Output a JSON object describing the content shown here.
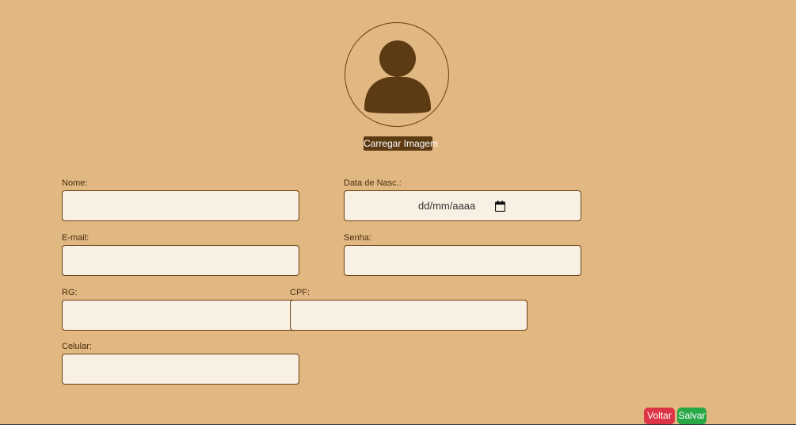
{
  "profile": {
    "avatar_icon": "user-silhouette-icon",
    "upload_label": "Carregar Imagem"
  },
  "form": {
    "nome": {
      "label": "Nome:",
      "value": ""
    },
    "data_nasc": {
      "label": "Data de Nasc.:",
      "placeholder": "dd/mm/aaaa",
      "icon": "calendar-icon"
    },
    "email": {
      "label": "E-mail:",
      "value": ""
    },
    "senha": {
      "label": "Senha:",
      "value": ""
    },
    "rg": {
      "label": "RG:",
      "value": ""
    },
    "cpf": {
      "label": "CPF:",
      "value": ""
    },
    "celular": {
      "label": "Celular:",
      "value": ""
    }
  },
  "actions": {
    "voltar_label": "Voltar",
    "salvar_label": "Salvar"
  },
  "colors": {
    "background": "#e1b782",
    "accent_brown": "#5c3a12",
    "input_background": "#f8f0e3",
    "voltar": "#dc3545",
    "salvar": "#28a745"
  }
}
